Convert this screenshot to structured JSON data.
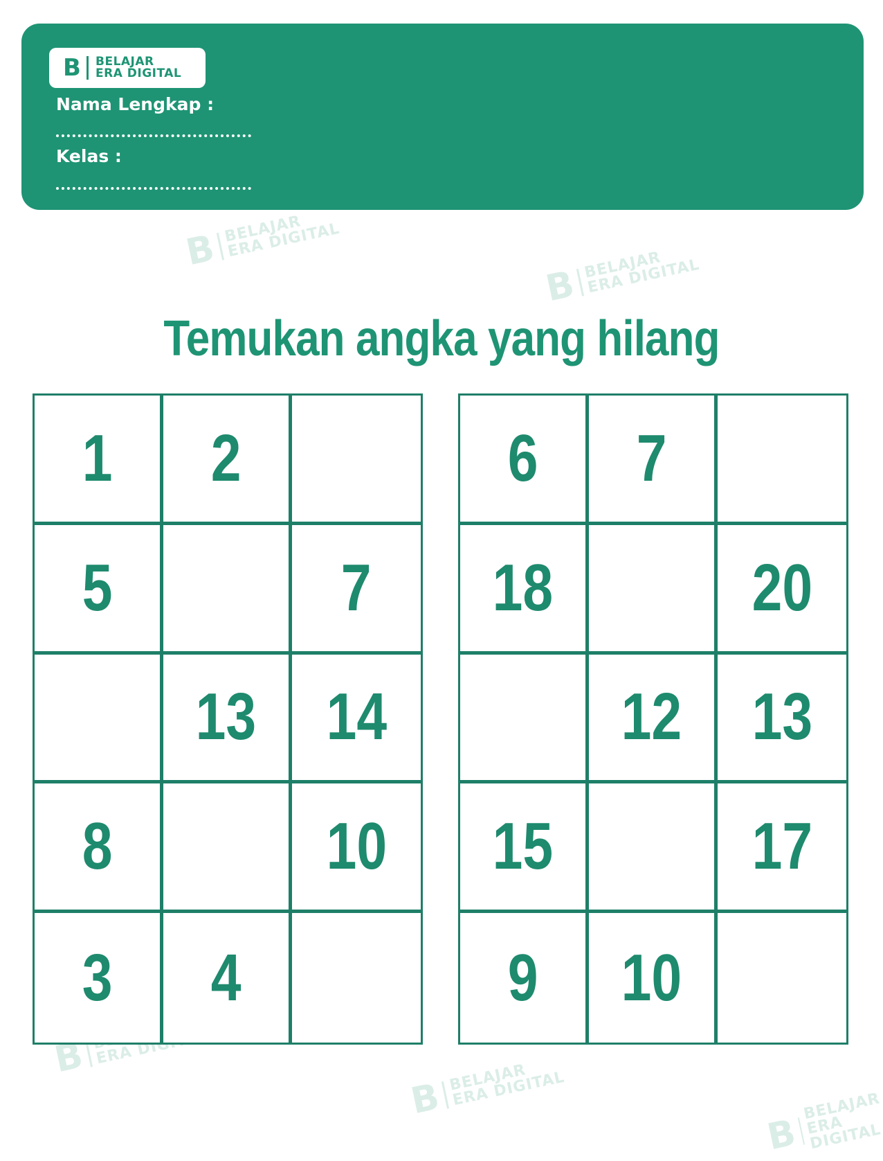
{
  "header": {
    "logo": {
      "line1": "BELAJAR",
      "line2": "ERA DIGITAL",
      "mark": "B"
    },
    "name_label": "Nama Lengkap :",
    "class_label": "Kelas :"
  },
  "title": "Temukan angka yang hilang",
  "grids": [
    [
      [
        "1",
        "2",
        ""
      ],
      [
        "5",
        "",
        "7"
      ],
      [
        "",
        "13",
        "14"
      ],
      [
        "8",
        "",
        "10"
      ],
      [
        "3",
        "4",
        ""
      ]
    ],
    [
      [
        "6",
        "7",
        ""
      ],
      [
        "18",
        "",
        "20"
      ],
      [
        "",
        "12",
        "13"
      ],
      [
        "15",
        "",
        "17"
      ],
      [
        "9",
        "10",
        ""
      ]
    ]
  ],
  "watermark": {
    "line1": "BELAJAR",
    "line2": "ERA DIGITAL",
    "mark": "B"
  },
  "colors": {
    "brand": "#1e9474",
    "grid_line": "#1e7f68",
    "digits": "#1e8a6e",
    "watermark": "#cfe8df"
  }
}
